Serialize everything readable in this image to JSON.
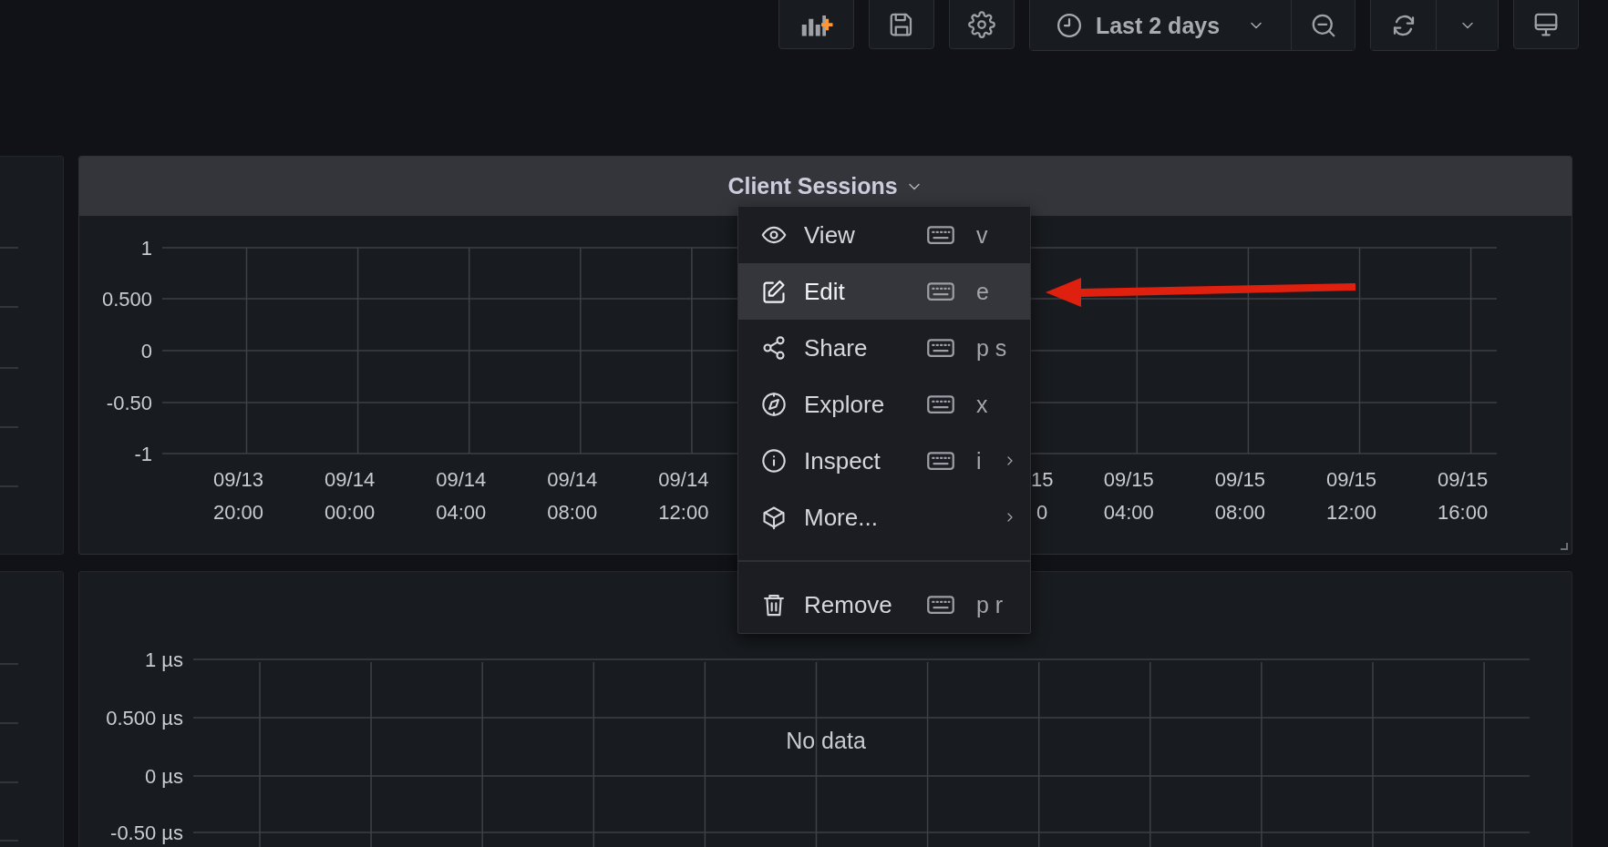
{
  "toolbar": {
    "time_range": "Last 2 days"
  },
  "panels": [
    {
      "title": "Client Sessions",
      "y_ticks": [
        "1",
        "0.500",
        "0",
        "-0.50",
        "-1"
      ],
      "x_ticks": [
        {
          "date": "09/13",
          "time": "20:00"
        },
        {
          "date": "09/14",
          "time": "00:00"
        },
        {
          "date": "09/14",
          "time": "04:00"
        },
        {
          "date": "09/14",
          "time": "08:00"
        },
        {
          "date": "09/14",
          "time": "12:00"
        },
        {
          "date": "15",
          "time": "0"
        },
        {
          "date": "09/15",
          "time": "04:00"
        },
        {
          "date": "09/15",
          "time": "08:00"
        },
        {
          "date": "09/15",
          "time": "12:00"
        },
        {
          "date": "09/15",
          "time": "16:00"
        }
      ]
    },
    {
      "y_ticks": [
        "1 µs",
        "0.500 µs",
        "0 µs",
        "-0.50 µs"
      ],
      "message": "No data"
    }
  ],
  "menu": {
    "groups": [
      [
        {
          "label": "View",
          "shortcut": "v",
          "selected": false,
          "submenu": false
        },
        {
          "label": "Edit",
          "shortcut": "e",
          "selected": true,
          "submenu": false
        },
        {
          "label": "Share",
          "shortcut": "p s",
          "selected": false,
          "submenu": false
        },
        {
          "label": "Explore",
          "shortcut": "x",
          "selected": false,
          "submenu": false
        },
        {
          "label": "Inspect",
          "shortcut": "i",
          "selected": false,
          "submenu": true
        },
        {
          "label": "More...",
          "selected": false,
          "submenu": true
        }
      ],
      [
        {
          "label": "Remove",
          "shortcut": "p r",
          "selected": false,
          "submenu": false
        }
      ]
    ]
  }
}
